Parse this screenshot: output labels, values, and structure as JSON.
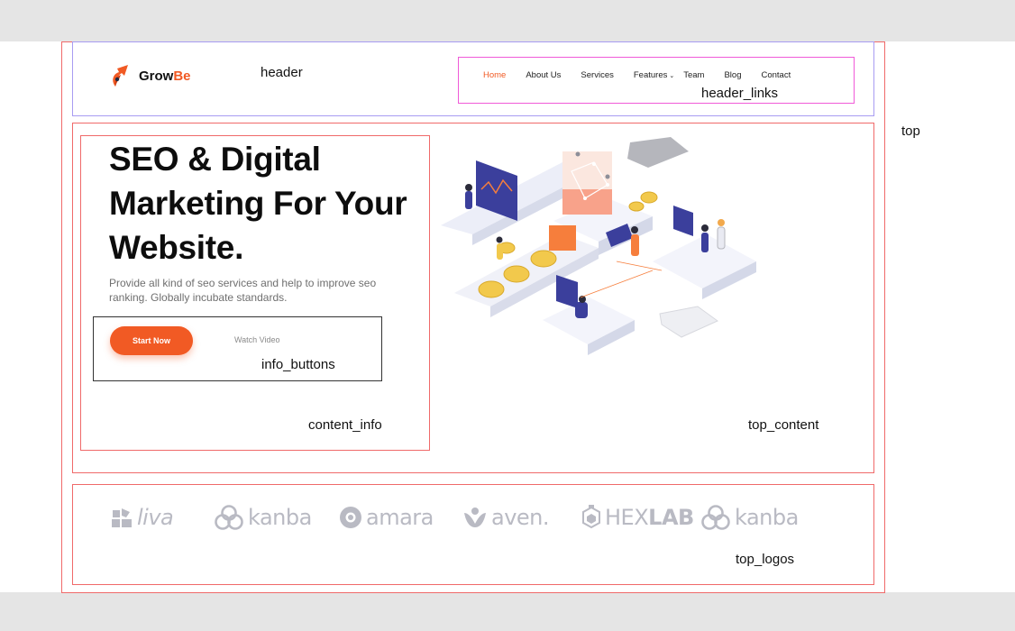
{
  "labels": {
    "top": "top",
    "header": "header",
    "header_links": "header_links",
    "content_info": "content_info",
    "info_buttons": "info_buttons",
    "top_content": "top_content",
    "top_logos": "top_logos"
  },
  "header": {
    "logo_text_dark": "Grow",
    "logo_text_accent": "Be",
    "nav": [
      {
        "label": "Home",
        "active": true
      },
      {
        "label": "About Us"
      },
      {
        "label": "Services"
      },
      {
        "label": "Features",
        "dropdown": true
      },
      {
        "label": "Team"
      },
      {
        "label": "Blog"
      },
      {
        "label": "Contact"
      }
    ]
  },
  "hero": {
    "headline": "SEO & Digital Marketing For Your Website.",
    "description": "Provide all kind of seo services and help to improve seo ranking. Globally incubate standards.",
    "primary_button": "Start Now",
    "secondary_button": "Watch Video"
  },
  "logos": [
    {
      "name": "liva",
      "icon": "liva-icon"
    },
    {
      "name": "kanba",
      "icon": "kanba-icon"
    },
    {
      "name": "amara",
      "icon": "amara-icon"
    },
    {
      "name": "aven.",
      "icon": "aven-icon"
    },
    {
      "name_light": "HEX",
      "name_bold": "LAB",
      "icon": "hexlab-icon"
    },
    {
      "name": "kanba",
      "icon": "kanba-icon"
    }
  ],
  "colors": {
    "accent": "#f15a24",
    "logo_gray": "#b9bac3"
  }
}
